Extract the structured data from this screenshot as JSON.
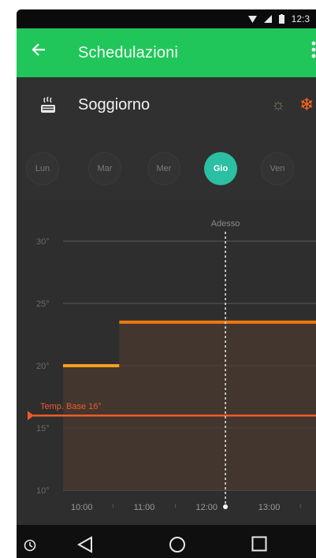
{
  "status_bar": {
    "time": "12:3"
  },
  "app_bar": {
    "back_icon": "arrow-left-icon",
    "title": "Schedulazioni",
    "menu_icon": "more-vert-icon"
  },
  "room": {
    "icon": "heater-icon",
    "name": "Soggiorno",
    "mode_icons": [
      "sun-icon",
      "snowflake-icon"
    ],
    "active_mode_color": "#ff6a1a"
  },
  "days": [
    {
      "label": "Lun",
      "active": false
    },
    {
      "label": "Mar",
      "active": false
    },
    {
      "label": "Mer",
      "active": false
    },
    {
      "label": "Gio",
      "active": true
    },
    {
      "label": "Ven",
      "active": false
    }
  ],
  "chart_data": {
    "type": "line",
    "y_ticks": [
      "30°",
      "25°",
      "20°",
      "15°",
      "10°"
    ],
    "x_ticks": [
      "10:00",
      "11:00",
      "12:00",
      "13:00"
    ],
    "now_label": "Adesso",
    "now_time": 12.3,
    "base_label": "Temp. Base 16°",
    "base_temp": 16,
    "ylim": [
      10,
      30
    ],
    "xlim": [
      9.7,
      13.75
    ],
    "series": [
      {
        "color": "#f5a020",
        "segments": [
          {
            "x0": 9.7,
            "x1": 10.6,
            "y": 20
          }
        ]
      },
      {
        "color": "#f07a10",
        "segments": [
          {
            "x0": 10.6,
            "x1": 13.75,
            "y": 23.5
          }
        ]
      }
    ],
    "colors": {
      "grid": "#5a5a5a",
      "base": "#f05a28",
      "fill": "#4a3a30"
    }
  },
  "nav_bar": {
    "back": "nav-back-icon",
    "home": "nav-home-icon",
    "recents": "nav-recents-icon",
    "clock": "clock-icon"
  }
}
